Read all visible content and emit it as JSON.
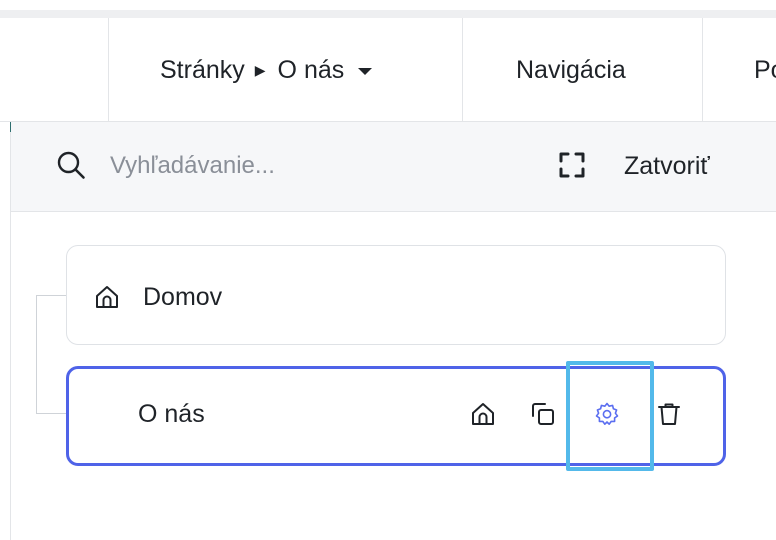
{
  "topbar": {
    "breadcrumb_root": "Stránky",
    "breadcrumb_current": "O nás",
    "tab_navigation": "Navigácia",
    "tab_partial": "Po"
  },
  "search": {
    "placeholder": "Vyhľadávanie...",
    "value": "",
    "close_label": "Zatvoriť"
  },
  "pages": [
    {
      "label": "Domov",
      "is_home": true
    },
    {
      "label": "O nás",
      "is_home": false,
      "selected": true
    }
  ],
  "icons": {
    "search": "search-icon",
    "expand": "expand-icon",
    "home": "home-icon",
    "duplicate": "copy-icon",
    "settings": "gear-icon",
    "delete": "trash-icon"
  },
  "colors": {
    "selected_border": "#4f63e8",
    "settings_icon": "#5b6ef0",
    "highlight": "#53b9ea"
  }
}
